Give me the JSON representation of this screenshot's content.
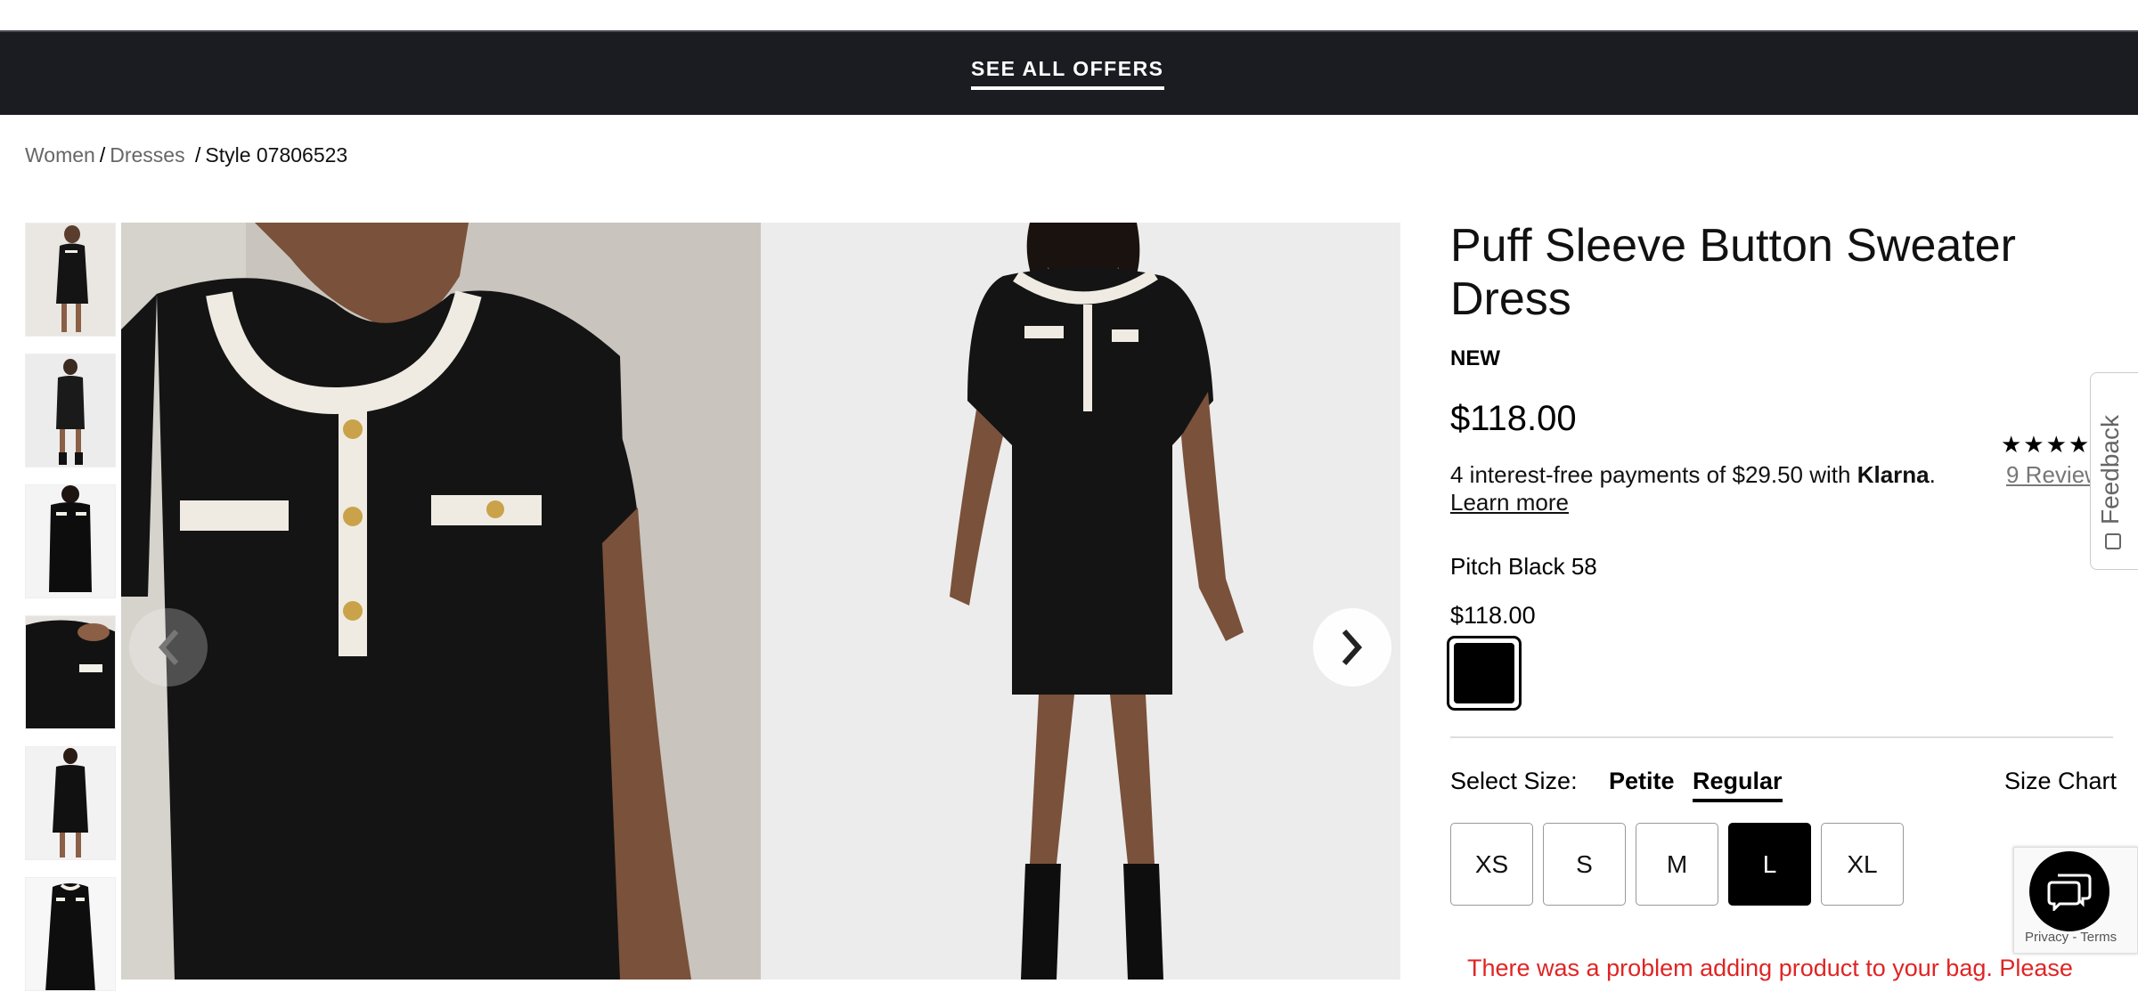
{
  "top_banner": {
    "offers_label": "SEE ALL OFFERS"
  },
  "breadcrumb": {
    "items": [
      "Women",
      "Dresses",
      "Style 07806523"
    ],
    "separator": "/"
  },
  "gallery": {
    "thumbnail_count": 6,
    "prev_icon": "chevron-left-icon",
    "next_icon": "chevron-right-icon"
  },
  "product": {
    "title": "Puff Sleeve Button Sweater Dress",
    "badge": "NEW",
    "price": "$118.00",
    "rating": {
      "stars": "★★★★",
      "reviews_label": "9 Review"
    },
    "klarna": {
      "text": "4 interest-free payments of $29.50 with",
      "brand": "Klarna",
      "learn_more": "Learn more"
    },
    "color": {
      "name": "Pitch Black 58",
      "price": "$118.00",
      "swatch_color": "#000000"
    },
    "size": {
      "label": "Select Size:",
      "fits": [
        "Petite",
        "Regular"
      ],
      "selected_fit": "Regular",
      "chart_label": "Size Chart",
      "options": [
        "XS",
        "S",
        "M",
        "L",
        "XL"
      ],
      "selected": "L"
    },
    "error_message": "There was a problem adding product to your bag. Please"
  },
  "feedback": {
    "label": "Feedback"
  },
  "recaptcha": {
    "text": "Privacy - Terms"
  },
  "chat": {
    "icon": "chat-icon"
  },
  "colors": {
    "banner_bg": "#1b1b22",
    "error": "#e02424",
    "accent": "#000000"
  }
}
